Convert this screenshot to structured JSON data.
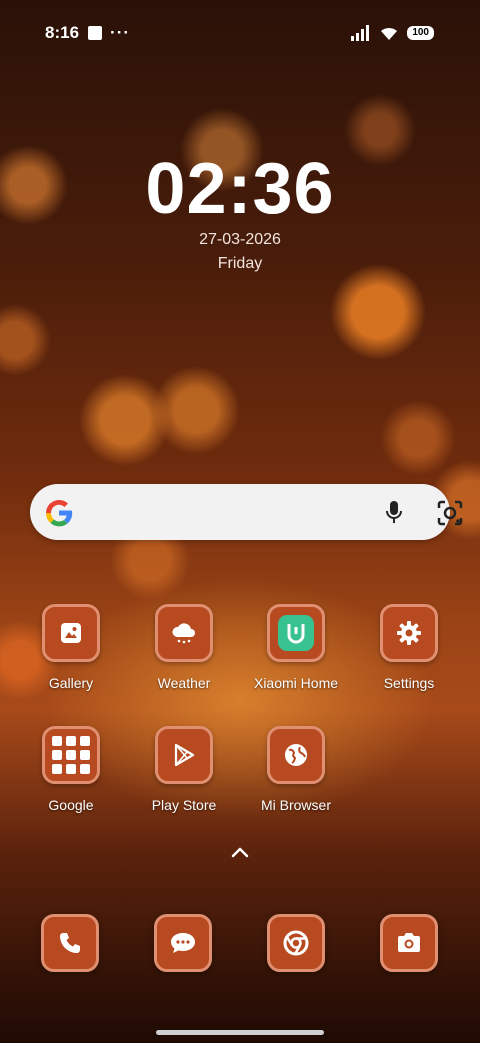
{
  "status_bar": {
    "time": "8:16",
    "dots": "···",
    "battery": "100"
  },
  "clock": {
    "time": "02:36",
    "date": "27-03-2026",
    "day": "Friday"
  },
  "apps": [
    {
      "label": "Gallery",
      "icon": "gallery-icon"
    },
    {
      "label": "Weather",
      "icon": "weather-icon"
    },
    {
      "label": "Xiaomi Home",
      "icon": "xiaomi-home-icon"
    },
    {
      "label": "Settings",
      "icon": "gear-icon"
    },
    {
      "label": "Google",
      "icon": "folder-icon"
    },
    {
      "label": "Play Store",
      "icon": "play-store-icon"
    },
    {
      "label": "Mi Browser",
      "icon": "globe-icon"
    }
  ],
  "dock": [
    "phone-icon",
    "messages-icon",
    "chrome-icon",
    "camera-icon"
  ],
  "colors": {
    "tile": "#b74a20",
    "tile_border": "#e09070",
    "xiaomi_home": "#38c28f"
  }
}
